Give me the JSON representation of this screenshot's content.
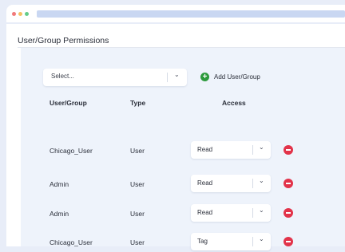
{
  "section_title": "User/Group Permissions",
  "group_select": {
    "value": "Select..."
  },
  "add_button_label": "Add User/Group",
  "table": {
    "headers": {
      "user_group": "User/Group",
      "type": "Type",
      "access": "Access"
    },
    "rows": [
      {
        "user_group": "Chicago_User",
        "type": "User",
        "access": "Read"
      },
      {
        "user_group": "Admin",
        "type": "User",
        "access": "Read"
      },
      {
        "user_group": "Admin",
        "type": "User",
        "access": "Read"
      },
      {
        "user_group": "Chicago_User",
        "type": "User",
        "access": "Tag"
      }
    ]
  },
  "colors": {
    "accent_green": "#2c9a3c",
    "remove_red": "#e2334a",
    "panel_bg": "#eef3fb"
  }
}
